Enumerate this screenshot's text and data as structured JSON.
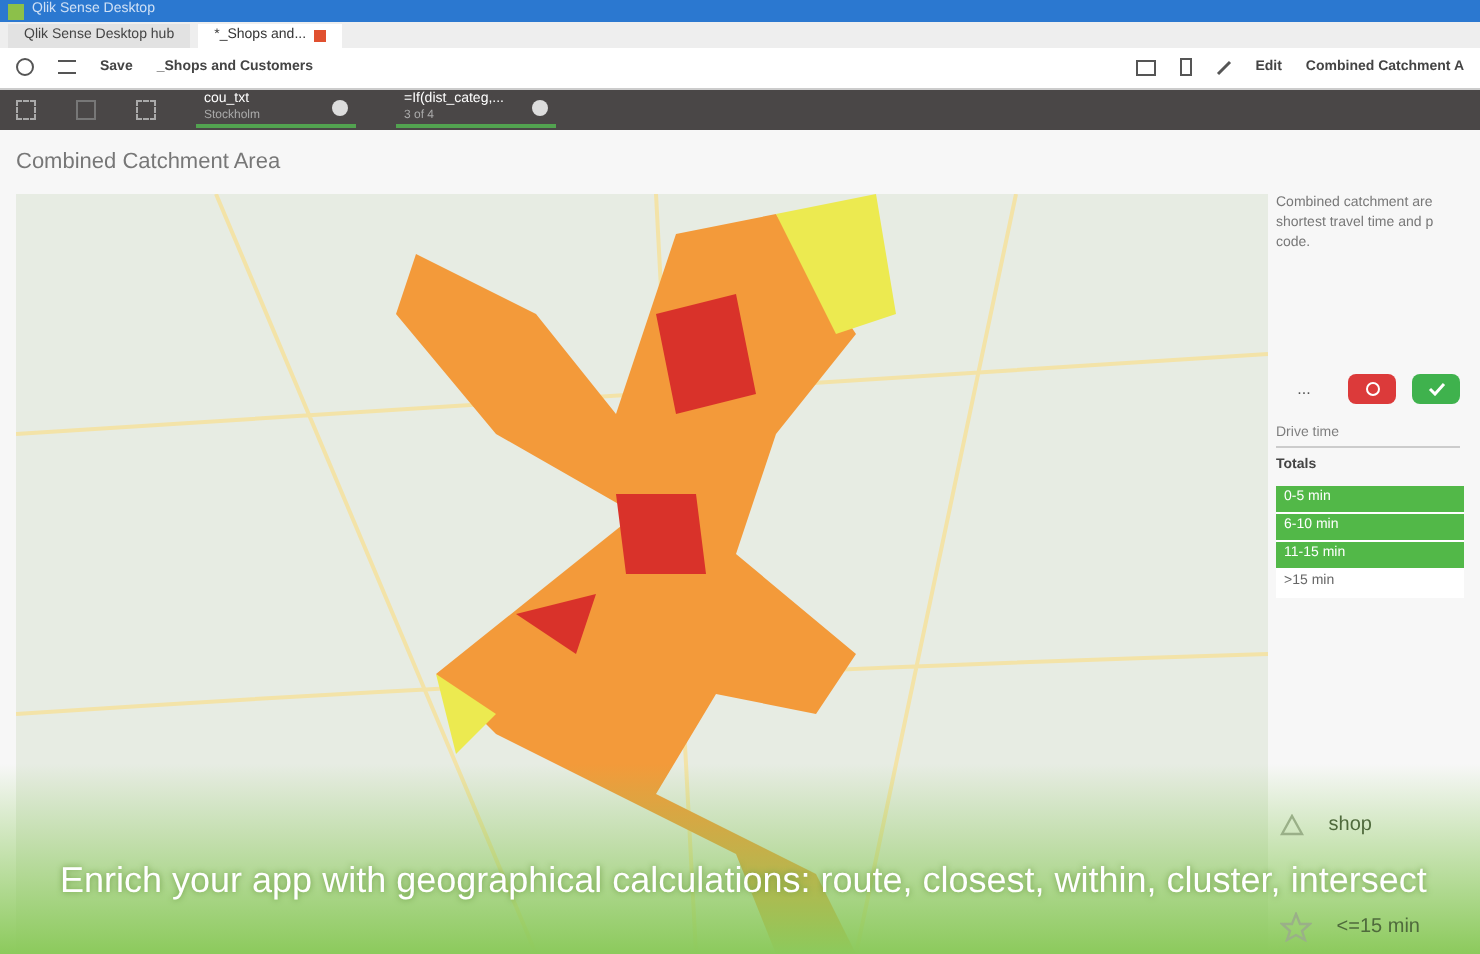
{
  "window": {
    "title": "Qlik Sense Desktop"
  },
  "tabs": [
    {
      "label": "Qlik Sense Desktop hub",
      "selected": false
    },
    {
      "label": "*_Shops and...",
      "selected": true
    }
  ],
  "toolbar": {
    "save": "Save",
    "app_name": "_Shops and Customers",
    "edit": "Edit",
    "sheet_title": "Combined Catchment A"
  },
  "selections": [
    {
      "field": "cou_txt",
      "value": "Stockholm"
    },
    {
      "field": "=If(dist_categ,...",
      "value": "3 of 4"
    }
  ],
  "chart": {
    "title": "Combined Catchment Area"
  },
  "description": [
    "Combined catchment are",
    "shortest travel time and p",
    "code."
  ],
  "filter": {
    "more": "...",
    "placeholder": "Drive time",
    "header": "Totals",
    "items": [
      {
        "label": "0-5 min",
        "selected": true
      },
      {
        "label": "6-10 min",
        "selected": true
      },
      {
        "label": "11-15 min",
        "selected": true
      },
      {
        "label": ">15 min",
        "selected": false
      }
    ]
  },
  "legend": [
    {
      "kind": "triangle",
      "label": "shop"
    },
    {
      "kind": "star",
      "label": "<=15 min"
    }
  ],
  "caption": "Enrich your app with geographical calculations: route, closest, within, cluster, intersect"
}
